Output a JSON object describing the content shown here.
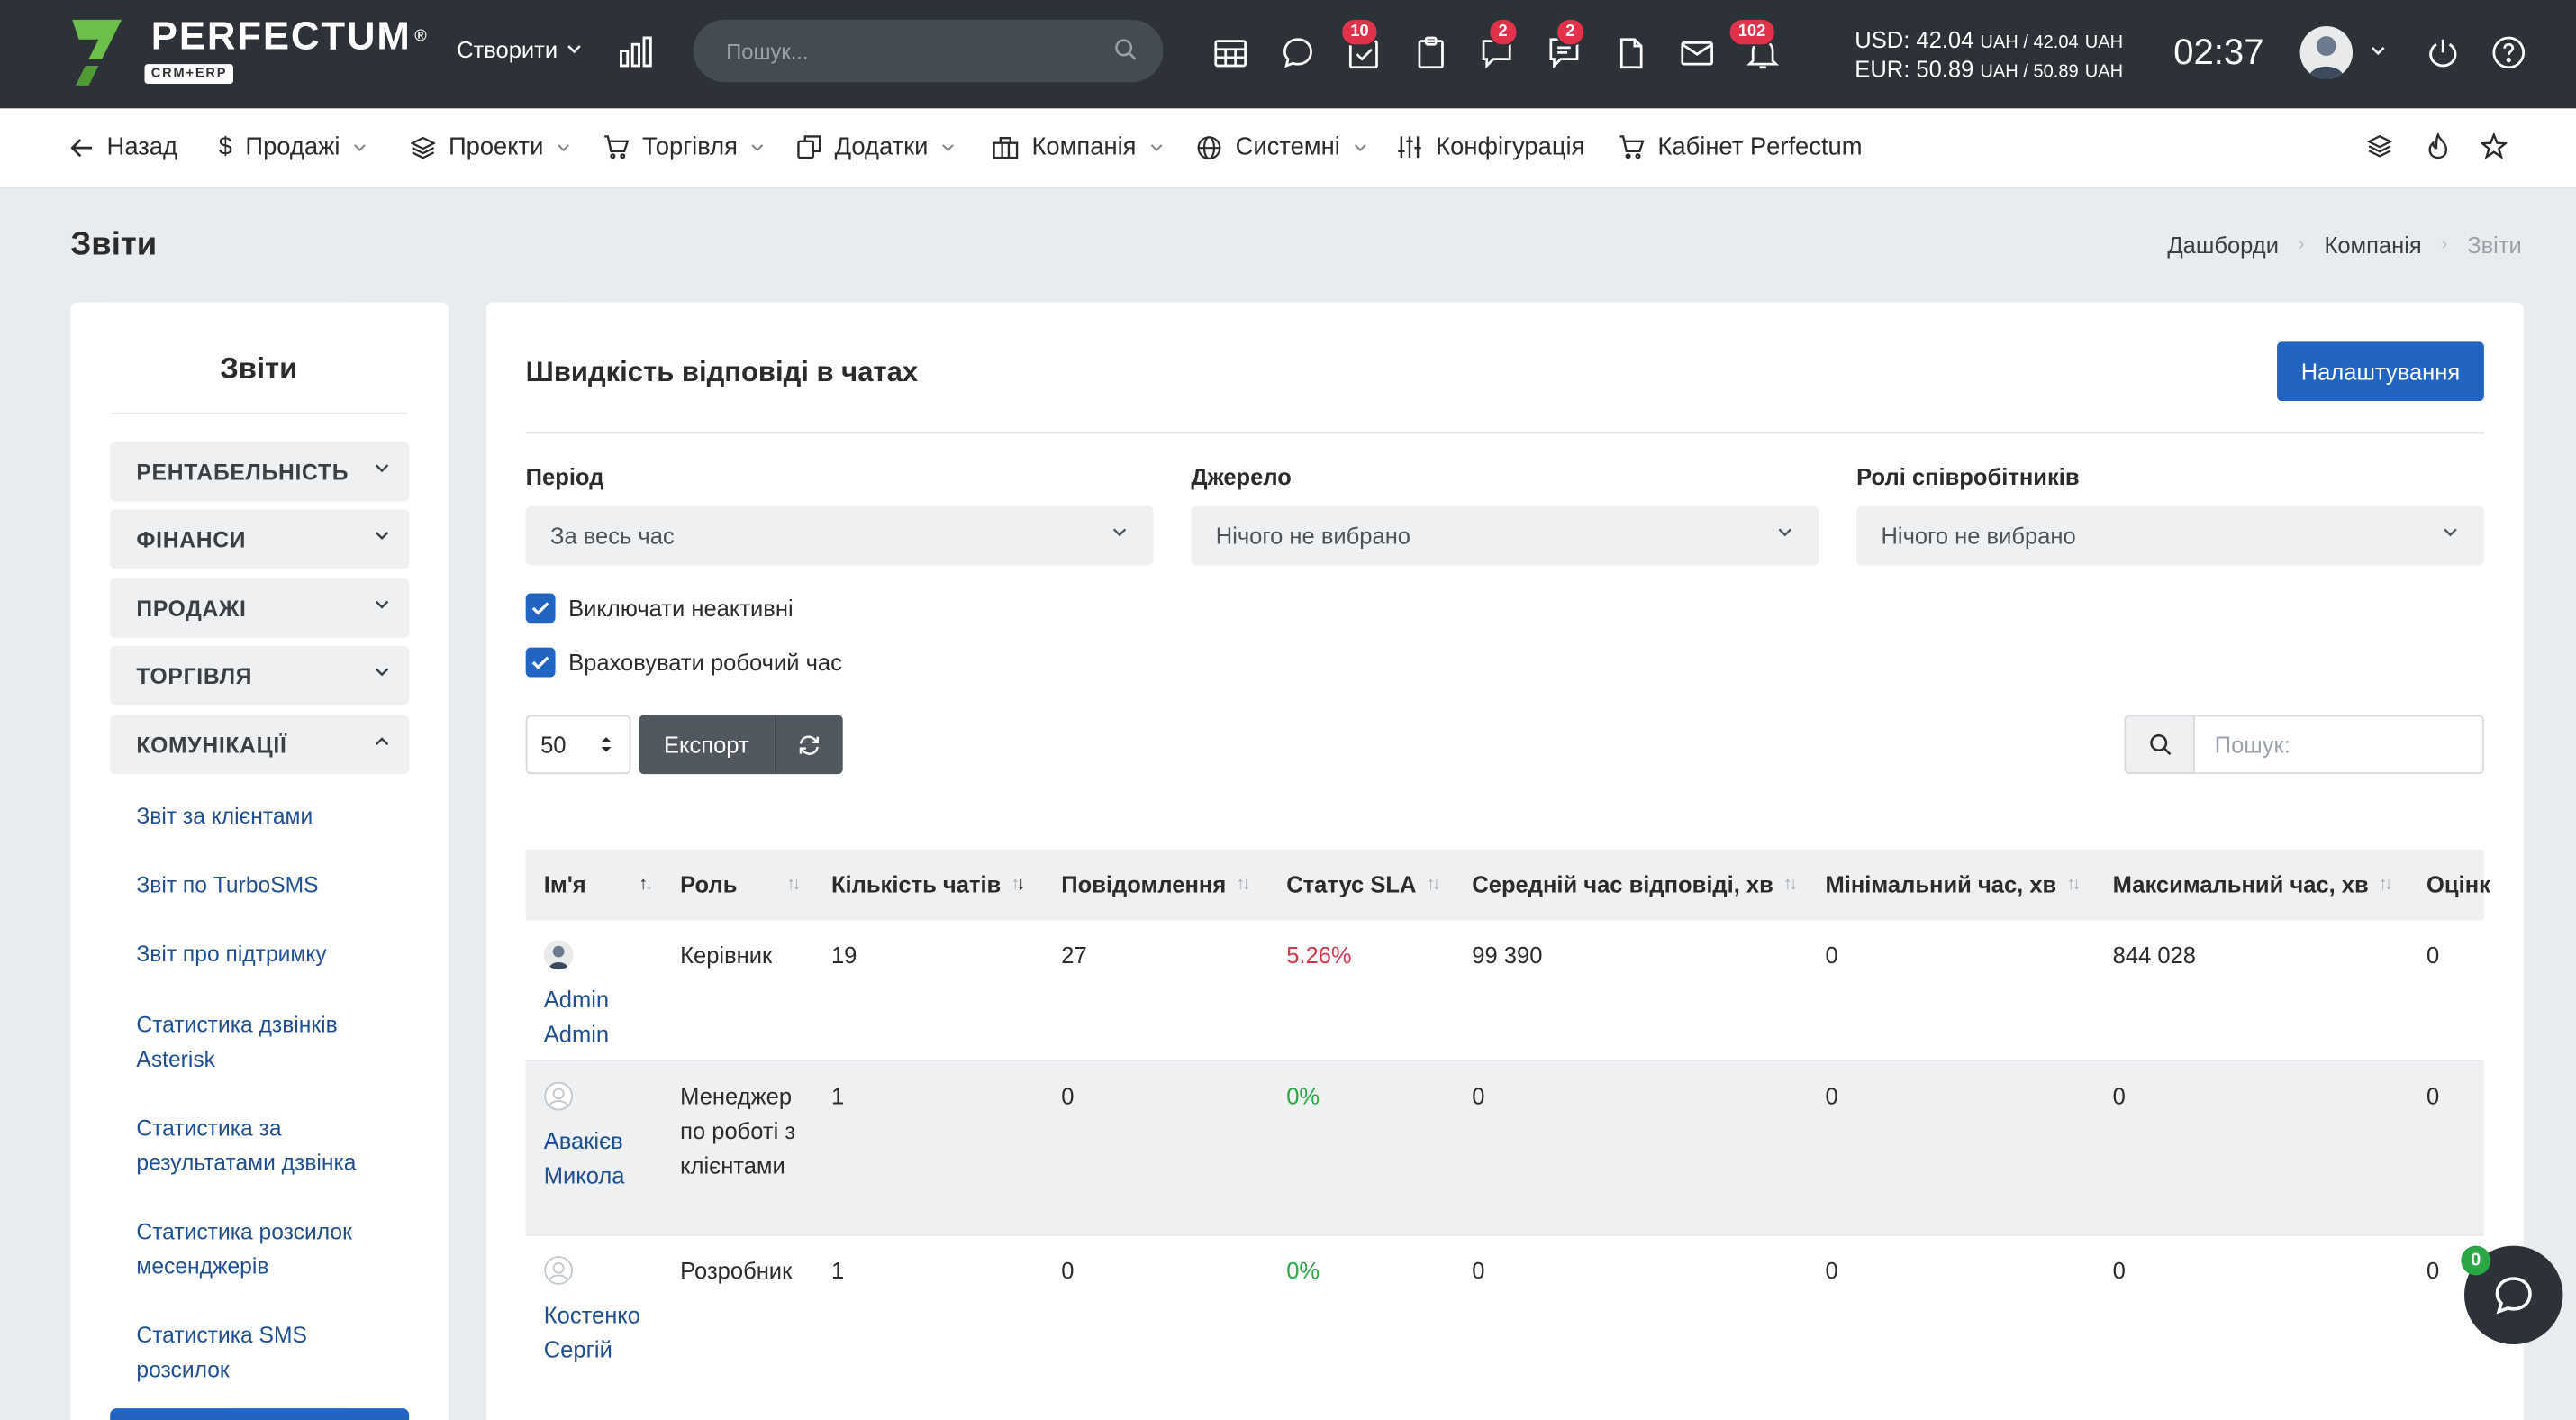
{
  "app": {
    "logo_text": "PERFECTUM",
    "logo_sub": "CRM+ERP",
    "logo_reg": "®",
    "brand_color": "#6dbf4b"
  },
  "topbar": {
    "create_label": "Створити",
    "search_placeholder": "Пошук...",
    "badges": {
      "tasks": "10",
      "chat": "2",
      "comments": "2",
      "notifications": "102"
    },
    "rates_usd": "USD: 42.04",
    "rates_usd_unit": "UAH / 42.04",
    "rates_usd_unit2": "UAH",
    "rates_eur": "EUR: 50.89",
    "rates_eur_unit": "UAH / 50.89",
    "rates_eur_unit2": "UAH",
    "clock": "02:37"
  },
  "nav": {
    "back": "Назад",
    "sales": "Продажі",
    "projects": "Проекти",
    "trade": "Торгівля",
    "addons": "Додатки",
    "company": "Компанія",
    "system": "Системні",
    "config": "Конфігурація",
    "cabinet": "Кабінет Perfectum"
  },
  "page": {
    "title": "Звіти",
    "breadcrumb": [
      "Дашборди",
      "Компанія",
      "Звіти"
    ]
  },
  "sidebar": {
    "title": "Звіти",
    "categories": [
      "РЕНТАБЕЛЬНІСТЬ",
      "ФІНАНСИ",
      "ПРОДАЖІ",
      "ТОРГІВЛЯ",
      "КОМУНІКАЦІЇ"
    ],
    "links": [
      "Звіт за клієнтами",
      "Звіт по TurboSMS",
      "Звіт про підтримку",
      "Статистика дзвінків Asterisk",
      "Статистика за результатами дзвінка",
      "Статистика розсилок месенджерів",
      "Статистика SMS розсилок"
    ]
  },
  "report": {
    "title": "Швидкість відповіді в чатах",
    "settings_button": "Налаштування",
    "filters": {
      "period_label": "Період",
      "period_value": "За весь час",
      "source_label": "Джерело",
      "source_value": "Нічого не вибрано",
      "roles_label": "Ролі співробітників",
      "roles_value": "Нічого не вибрано"
    },
    "checkboxes": [
      "Виключати неактивні",
      "Враховувати робочий час"
    ],
    "page_size": "50",
    "export_button": "Експорт",
    "search_placeholder": "Пошук:",
    "columns": [
      "Ім'я",
      "Роль",
      "Кількість чатів",
      "Повідомлення",
      "Статус SLA",
      "Середній час відповіді, хв",
      "Мінімальний час, хв",
      "Максимальний час, хв",
      "Оцінк"
    ],
    "rows": [
      {
        "name1": "Admin",
        "name2": "Admin",
        "role": "Керівник",
        "chats": "19",
        "messages": "27",
        "sla": "5.26%",
        "avg": "99 390",
        "min": "0",
        "max": "844 028",
        "rating": "0"
      },
      {
        "name1": "Авакієв",
        "name2": "Микола",
        "role": "Менеджер по роботі з клієнтами",
        "chats": "1",
        "messages": "0",
        "sla": "0%",
        "avg": "0",
        "min": "0",
        "max": "0",
        "rating": "0"
      },
      {
        "name1": "Костенко",
        "name2": "Сергій",
        "role": "Розробник",
        "chats": "1",
        "messages": "0",
        "sla": "0%",
        "avg": "0",
        "min": "0",
        "max": "0",
        "rating": "0"
      }
    ]
  },
  "chat_widget": {
    "badge": "0"
  }
}
